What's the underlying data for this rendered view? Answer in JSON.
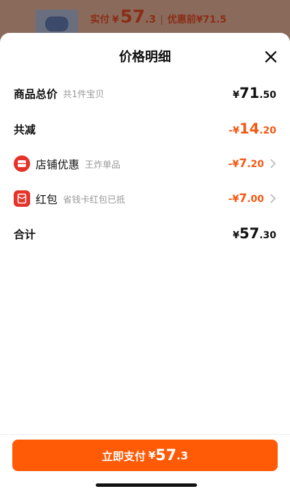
{
  "background": {
    "paid_label": "实付",
    "paid_currency": "¥",
    "paid_int": "57",
    "paid_dec": ".3",
    "separator": "|",
    "original_label": "优惠前¥71.5"
  },
  "sheet": {
    "title": "价格明细",
    "rows": {
      "total": {
        "label": "商品总价",
        "sub": "共1件宝贝",
        "currency": "¥",
        "int": "71",
        "dec": ".50"
      },
      "reduce": {
        "label": "共减",
        "currency": "-¥",
        "int": "14",
        "dec": ".20"
      },
      "shop": {
        "label": "店铺优惠",
        "sub": "王炸单品",
        "currency": "-¥",
        "int": "7",
        "dec": ".20"
      },
      "redpacket": {
        "label": "红包",
        "sub": "省钱卡红包已抵",
        "currency": "-¥",
        "int": "7",
        "dec": ".00"
      },
      "sum": {
        "label": "合计",
        "currency": "¥",
        "int": "57",
        "dec": ".30"
      }
    }
  },
  "pay_button": {
    "label": "立即支付",
    "currency": "¥",
    "int": "57",
    "dec": ".3"
  },
  "colors": {
    "accent": "#ff5a06",
    "discount": "#f25a14",
    "badge": "#e5332a"
  },
  "icons": {
    "close": "close-icon",
    "shop": "shop-coupon-icon",
    "redpacket": "red-packet-icon",
    "chevron": "chevron-right-icon"
  }
}
